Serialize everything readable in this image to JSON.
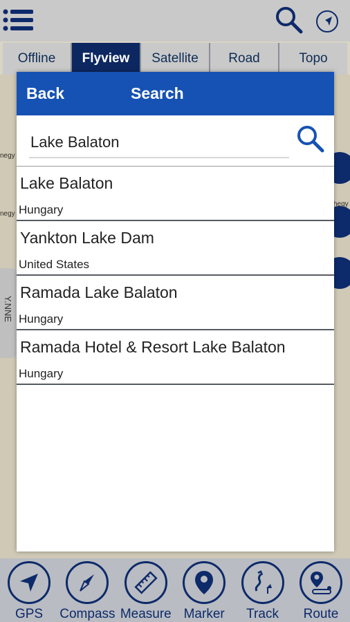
{
  "colors": {
    "header_blue": "#1652b3",
    "navy": "#0d2a6a",
    "active_tab": "#0d2760",
    "map_background": "#cfc9b6"
  },
  "topbar": {
    "icons": [
      "menu-icon",
      "search-icon",
      "compass-icon"
    ]
  },
  "tabs": [
    {
      "label": "Offline",
      "active": false
    },
    {
      "label": "Flyview",
      "active": true
    },
    {
      "label": "Satellite",
      "active": false
    },
    {
      "label": "Road",
      "active": false
    },
    {
      "label": "Topo",
      "active": false
    }
  ],
  "map": {
    "labels": [
      "negy",
      "negy",
      "hegy"
    ],
    "side_handle_text": "Y.NNE"
  },
  "dialog": {
    "back_label": "Back",
    "title": "Search",
    "search_value": "Lake Balaton",
    "results": [
      {
        "name": "Lake Balaton",
        "country": "Hungary"
      },
      {
        "name": "Yankton Lake Dam",
        "country": "United States"
      },
      {
        "name": "Ramada Lake Balaton",
        "country": "Hungary"
      },
      {
        "name": "Ramada Hotel & Resort Lake Balaton",
        "country": "Hungary"
      }
    ]
  },
  "bottom_tools": [
    {
      "label": "GPS",
      "icon": "navigation-arrow-icon"
    },
    {
      "label": "Compass",
      "icon": "compass-icon"
    },
    {
      "label": "Measure",
      "icon": "ruler-icon"
    },
    {
      "label": "Marker",
      "icon": "map-pin-icon"
    },
    {
      "label": "Track",
      "icon": "track-icon"
    },
    {
      "label": "Route",
      "icon": "route-icon"
    }
  ]
}
